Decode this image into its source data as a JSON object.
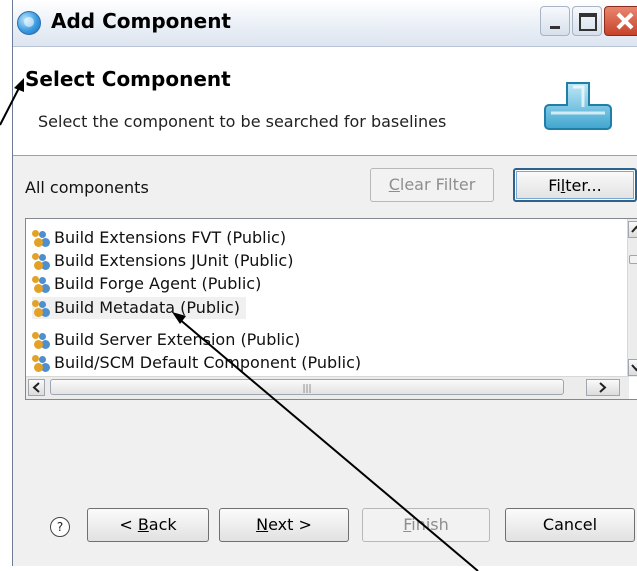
{
  "window": {
    "title": "Add Component",
    "icon": "globe-icon"
  },
  "header": {
    "title": "Select Component",
    "description": "Select the component to be searched for baselines"
  },
  "filter": {
    "label": "All components",
    "clear_filter_prefix": "",
    "clear_filter_mnemonic": "C",
    "clear_filter_rest": "lear Filter",
    "filter_prefix": "Fi",
    "filter_mnemonic": "l",
    "filter_rest": "ter..."
  },
  "components": [
    "Build Extensions FVT (Public)",
    "Build Extensions JUnit (Public)",
    "Build Forge Agent (Public)",
    "Build Metadata (Public)",
    "Build Server Extension (Public)",
    "Build/SCM Default Component (Public)"
  ],
  "buttons": {
    "help": "?",
    "back_prefix": "< ",
    "back_mnemonic": "B",
    "back_rest": "ack",
    "next_mnemonic": "N",
    "next_rest": "ext >",
    "finish_mnemonic": "F",
    "finish_rest": "inish",
    "cancel": "Cancel"
  },
  "state": {
    "selected_component_index": 3
  },
  "colors": {
    "accent_default_button": "#2c628b",
    "close_button": "#c7422a",
    "disabled_text": "#8e8e8e"
  }
}
